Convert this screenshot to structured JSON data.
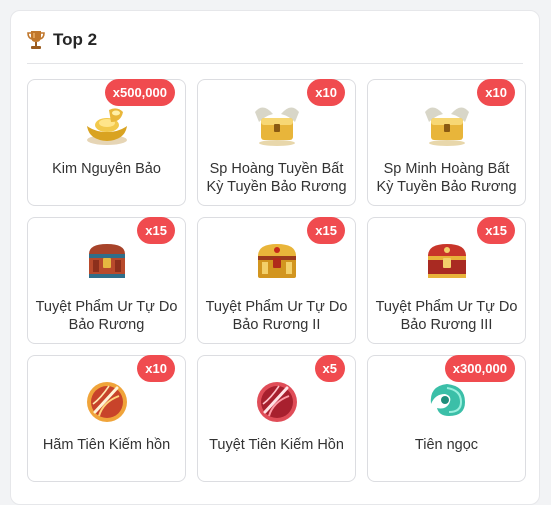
{
  "header": {
    "title": "Top 2",
    "icon": "trophy-icon"
  },
  "items": [
    {
      "badge": "x500,000",
      "name": "Kim Nguyên Bảo",
      "icon": "gold-ingot-icon"
    },
    {
      "badge": "x10",
      "name": "Sp Hoàng Tuyền Bất Kỳ Tuyền Bảo Rương",
      "icon": "winged-chest-icon"
    },
    {
      "badge": "x10",
      "name": "Sp Minh Hoàng Bất Kỳ Tuyền Bảo Rương",
      "icon": "winged-chest-icon"
    },
    {
      "badge": "x15",
      "name": "Tuyệt Phẩm Ur Tự Do Bảo Rương",
      "icon": "treasure-chest-icon"
    },
    {
      "badge": "x15",
      "name": "Tuyệt Phẩm Ur Tự Do Bảo Rương II",
      "icon": "treasure-chest-icon"
    },
    {
      "badge": "x15",
      "name": "Tuyệt Phẩm Ur Tự Do Bảo Rương III",
      "icon": "treasure-chest-icon"
    },
    {
      "badge": "x10",
      "name": "Hãm Tiên Kiếm hồn",
      "icon": "sword-soul-orb-icon"
    },
    {
      "badge": "x5",
      "name": "Tuyệt Tiên Kiếm Hồn",
      "icon": "sword-soul-orb-icon"
    },
    {
      "badge": "x300,000",
      "name": "Tiên ngọc",
      "icon": "jade-icon"
    }
  ],
  "colors": {
    "badge": "#f04b4f",
    "border": "#dcdde1",
    "text": "#333333"
  }
}
